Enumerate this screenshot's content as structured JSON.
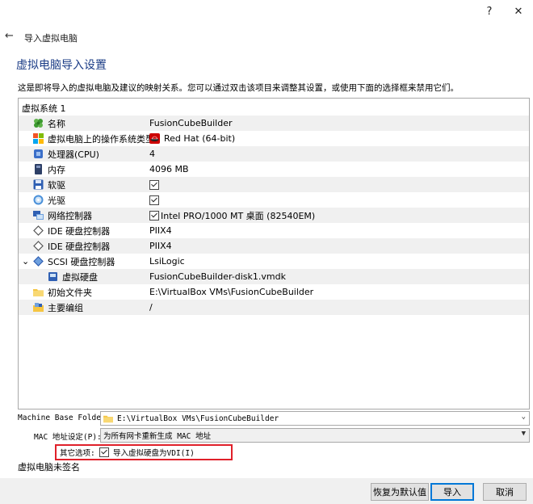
{
  "window": {
    "help_glyph": "?",
    "close_glyph": "✕"
  },
  "wizard": {
    "back_glyph": "←",
    "title": "导入虚拟电脑"
  },
  "page": {
    "heading": "虚拟电脑导入设置",
    "description": "这是即将导入的虚拟电脑及建议的映射关系。您可以通过双击该项目来调整其设置，或使用下面的选择框来禁用它们。"
  },
  "tree": {
    "root_label": "虚拟系统 1",
    "rows": [
      {
        "label": "名称",
        "value": "FusionCubeBuilder",
        "icon": "name-icon"
      },
      {
        "label": "虚拟电脑上的操作系统类型",
        "value": "Red Hat (64-bit)",
        "icon": "os-type-icon"
      },
      {
        "label": "处理器(CPU)",
        "value": "4",
        "icon": "cpu-icon"
      },
      {
        "label": "内存",
        "value": "4096 MB",
        "icon": "memory-icon"
      },
      {
        "label": "软驱",
        "value": "",
        "icon": "floppy-icon"
      },
      {
        "label": "光驱",
        "value": "",
        "icon": "optical-drive-icon"
      },
      {
        "label": "网络控制器",
        "value": "Intel PRO/1000 MT 桌面 (82540EM)",
        "icon": "network-icon"
      },
      {
        "label": "IDE 硬盘控制器",
        "value": "PIIX4",
        "icon": "ide-controller-icon"
      },
      {
        "label": "IDE 硬盘控制器",
        "value": "PIIX4",
        "icon": "ide-controller-icon"
      },
      {
        "label": "SCSI 硬盘控制器",
        "value": "LsiLogic",
        "icon": "scsi-controller-icon"
      },
      {
        "label": "虚拟硬盘",
        "value": "FusionCubeBuilder-disk1.vmdk",
        "icon": "hard-disk-icon"
      },
      {
        "label": "初始文件夹",
        "value": "E:\\VirtualBox VMs\\FusionCubeBuilder",
        "icon": "folder-icon"
      },
      {
        "label": "主要编组",
        "value": "/",
        "icon": "group-icon"
      }
    ],
    "expand_glyph": "⌄"
  },
  "options": {
    "base_folder_label": "Machine Base Folder:",
    "base_folder_value": "E:\\VirtualBox VMs\\FusionCubeBuilder",
    "mac_label": "MAC 地址设定(P):",
    "mac_value": "为所有网卡重新生成 MAC 地址",
    "other_label": "其它选项:",
    "import_vdi_label": "导入虚拟硬盘为VDI(I)",
    "import_vdi_checked": true,
    "signature_status": "虚拟电脑未签名"
  },
  "buttons": {
    "restore_defaults": "恢复为默认值",
    "import": "导入",
    "cancel": "取消"
  },
  "colors": {
    "heading": "#1b3c86",
    "highlight_box": "#e0202a",
    "primary_border": "#0078d7"
  }
}
